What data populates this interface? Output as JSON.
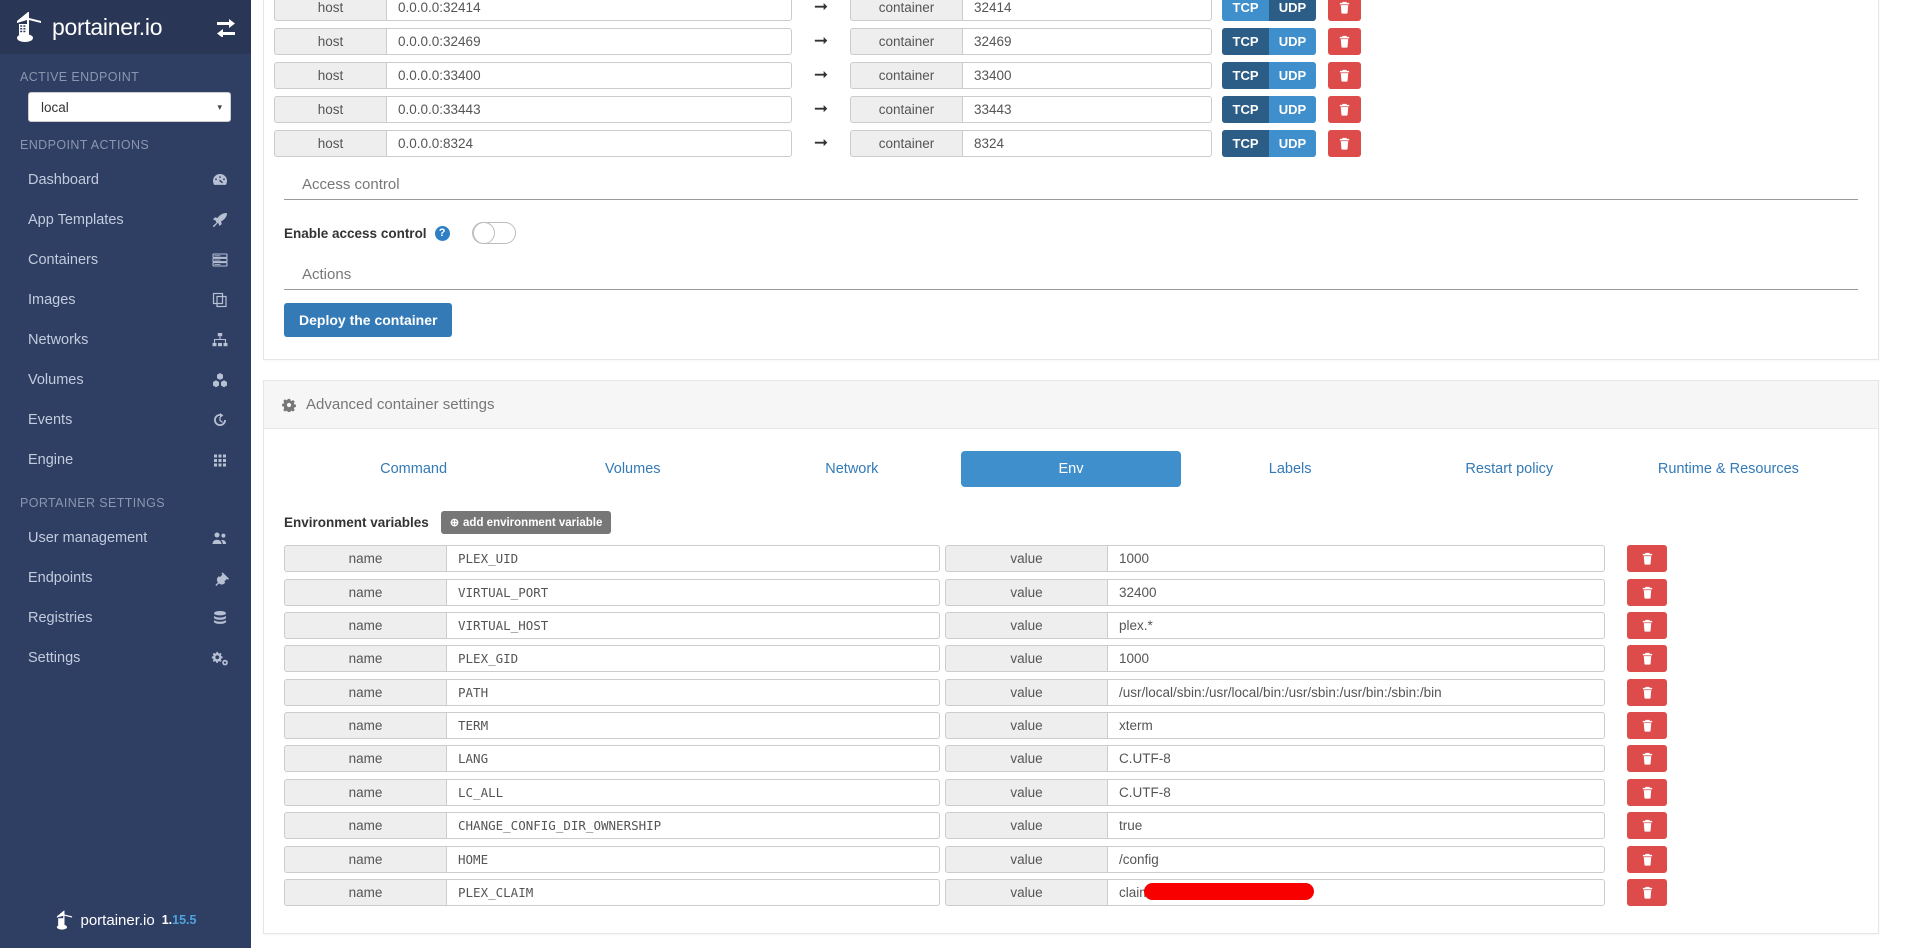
{
  "brand": {
    "name": "portainer.io",
    "version": "1.15.5",
    "version_a": "1.",
    "version_b": "15.5",
    "toggle_icon": "sidebar-toggle-icon"
  },
  "sidebar": {
    "active_endpoint_heading": "ACTIVE ENDPOINT",
    "endpoint_value": "local",
    "endpoint_caret": "▾",
    "endpoint_actions_heading": "ENDPOINT ACTIONS",
    "portainer_settings_heading": "PORTAINER SETTINGS",
    "endpoint_items": [
      {
        "label": "Dashboard",
        "icon": "dashboard-icon"
      },
      {
        "label": "App Templates",
        "icon": "rocket-icon"
      },
      {
        "label": "Containers",
        "icon": "server-icon"
      },
      {
        "label": "Images",
        "icon": "copy-icon"
      },
      {
        "label": "Networks",
        "icon": "sitemap-icon"
      },
      {
        "label": "Volumes",
        "icon": "cubes-icon"
      },
      {
        "label": "Events",
        "icon": "history-icon"
      },
      {
        "label": "Engine",
        "icon": "grid-icon"
      }
    ],
    "settings_items": [
      {
        "label": "User management",
        "icon": "users-icon"
      },
      {
        "label": "Endpoints",
        "icon": "plug-icon"
      },
      {
        "label": "Registries",
        "icon": "database-icon"
      },
      {
        "label": "Settings",
        "icon": "gears-icon"
      }
    ]
  },
  "ports": {
    "host_label": "host",
    "container_label": "container",
    "arrow": "➞",
    "tcp_label": "TCP",
    "udp_label": "UDP",
    "rows": [
      {
        "host": "0.0.0.0:32414",
        "container": "32414",
        "protocol": "TCP"
      },
      {
        "host": "0.0.0.0:32469",
        "container": "32469",
        "protocol": "UDP"
      },
      {
        "host": "0.0.0.0:33400",
        "container": "33400",
        "protocol": "UDP"
      },
      {
        "host": "0.0.0.0:33443",
        "container": "33443",
        "protocol": "UDP"
      },
      {
        "host": "0.0.0.0:8324",
        "container": "8324",
        "protocol": "UDP"
      }
    ]
  },
  "access_control": {
    "section_title": "Access control",
    "enable_label": "Enable access control",
    "help_glyph": "?",
    "enabled": false
  },
  "actions": {
    "section_title": "Actions",
    "deploy_label": "Deploy the container"
  },
  "advanced": {
    "header_title": "Advanced container settings",
    "header_icon": "gear-icon",
    "tabs": [
      {
        "label": "Command",
        "active": false
      },
      {
        "label": "Volumes",
        "active": false
      },
      {
        "label": "Network",
        "active": false
      },
      {
        "label": "Env",
        "active": true
      },
      {
        "label": "Labels",
        "active": false
      },
      {
        "label": "Restart policy",
        "active": false
      },
      {
        "label": "Runtime & Resources",
        "active": false
      }
    ],
    "env_title": "Environment variables",
    "add_button_label": "add environment variable",
    "add_button_icon": "plus-circle-icon",
    "name_label": "name",
    "value_label": "value",
    "variables": [
      {
        "name": "PLEX_UID",
        "value": "1000"
      },
      {
        "name": "VIRTUAL_PORT",
        "value": "32400"
      },
      {
        "name": "VIRTUAL_HOST",
        "value": "plex.*"
      },
      {
        "name": "PLEX_GID",
        "value": "1000"
      },
      {
        "name": "PATH",
        "value": "/usr/local/sbin:/usr/local/bin:/usr/sbin:/usr/bin:/sbin:/bin"
      },
      {
        "name": "TERM",
        "value": "xterm"
      },
      {
        "name": "LANG",
        "value": "C.UTF-8"
      },
      {
        "name": "LC_ALL",
        "value": "C.UTF-8"
      },
      {
        "name": "CHANGE_CONFIG_DIR_OWNERSHIP",
        "value": "true"
      },
      {
        "name": "HOME",
        "value": "/config"
      },
      {
        "name": "PLEX_CLAIM",
        "value": "claim-",
        "redacted": true
      }
    ]
  },
  "colors": {
    "sidebar_bg": "#2f3e63",
    "sidebar_logo_bg": "#293655",
    "accent_blue": "#337ab7",
    "tab_active": "#3e8fcc",
    "proto_selected": "#3e8fcc",
    "proto_unselected": "#2c5d86",
    "danger_red": "#dd4b4b",
    "redaction_red": "#f80000",
    "add_button_gray": "#777777"
  }
}
